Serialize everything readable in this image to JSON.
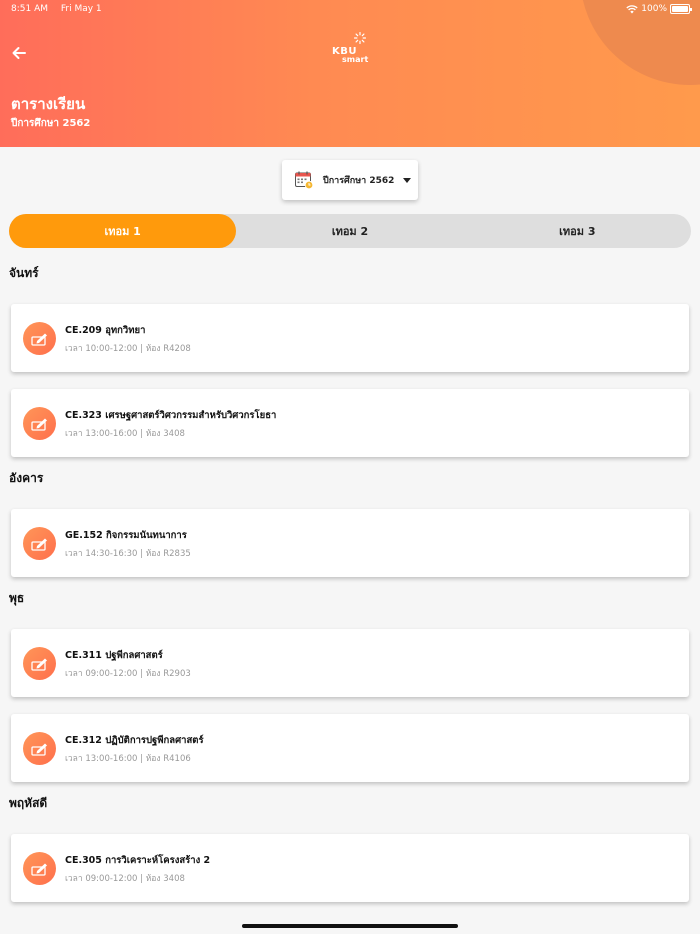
{
  "status_bar": {
    "time": "8:51 AM",
    "date": "Fri May 1",
    "battery": "100%"
  },
  "header": {
    "logo_kbu": "KBU",
    "logo_smart": "smart",
    "title": "ตารางเรียน",
    "subtitle": "ปีการศึกษา 2562",
    "back_icon": "arrow-left-icon",
    "colors": {
      "gradient_start": "#ff6d5a",
      "gradient_end": "#ff9a4c"
    }
  },
  "year_selector": {
    "label": "ปีการศึกษา 2562",
    "icon": "calendar-icon"
  },
  "tabs": [
    {
      "label": "เทอม 1",
      "active": true
    },
    {
      "label": "เทอม 2",
      "active": false
    },
    {
      "label": "เทอม 3",
      "active": false
    }
  ],
  "accent_color": "#ff9a0c",
  "schedule": [
    {
      "day": "จันทร์",
      "classes": [
        {
          "title": "CE.209 อุทกวิทยา",
          "detail": "เวลา 10:00-12:00 | ห้อง R4208"
        },
        {
          "title": "CE.323 เศรษฐศาสตร์วิศวกรรมสำหรับวิศวกรโยธา",
          "detail": "เวลา 13:00-16:00 | ห้อง 3408"
        }
      ]
    },
    {
      "day": "อังคาร",
      "classes": [
        {
          "title": "GE.152 กิจกรรมนันทนาการ",
          "detail": "เวลา 14:30-16:30 | ห้อง R2835"
        }
      ]
    },
    {
      "day": "พุธ",
      "classes": [
        {
          "title": "CE.311 ปฐพีกลศาสตร์",
          "detail": "เวลา 09:00-12:00 | ห้อง R2903"
        },
        {
          "title": "CE.312 ปฏิบัติการปฐพีกลศาสตร์",
          "detail": "เวลา 13:00-16:00 | ห้อง R4106"
        }
      ]
    },
    {
      "day": "พฤหัสดี",
      "classes": [
        {
          "title": "CE.305 การวิเคราะห์โครงสร้าง 2",
          "detail": "เวลา 09:00-12:00 | ห้อง 3408"
        }
      ]
    }
  ]
}
